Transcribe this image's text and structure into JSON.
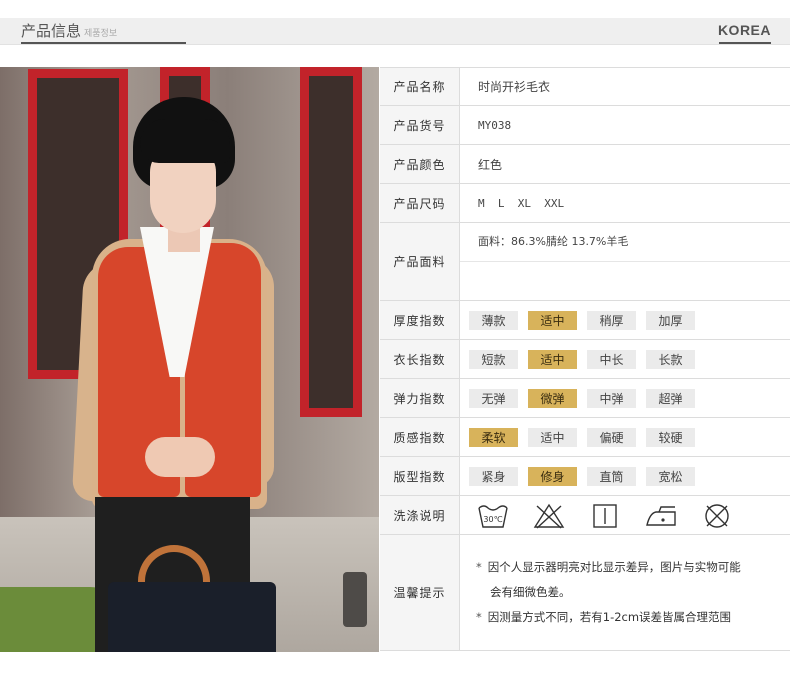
{
  "header": {
    "title": "产品信息",
    "subtitle": "제품정보",
    "brand": "KOREA"
  },
  "specs": {
    "name": {
      "label": "产品名称",
      "value": "时尚开衫毛衣"
    },
    "code": {
      "label": "产品货号",
      "value": "MY038"
    },
    "color": {
      "label": "产品颜色",
      "value": "红色"
    },
    "size": {
      "label": "产品尺码",
      "value": "M  L  XL  XXL"
    },
    "fabric": {
      "label": "产品面料",
      "value": "面料：86.3%腈纶 13.7%羊毛"
    }
  },
  "indices": [
    {
      "label": "厚度指数",
      "options": [
        "薄款",
        "适中",
        "稍厚",
        "加厚"
      ],
      "selected": 1
    },
    {
      "label": "衣长指数",
      "options": [
        "短款",
        "适中",
        "中长",
        "长款"
      ],
      "selected": 1
    },
    {
      "label": "弹力指数",
      "options": [
        "无弹",
        "微弹",
        "中弹",
        "超弹"
      ],
      "selected": 1
    },
    {
      "label": "质感指数",
      "options": [
        "柔软",
        "适中",
        "偏硬",
        "较硬"
      ],
      "selected": 0
    },
    {
      "label": "版型指数",
      "options": [
        "紧身",
        "修身",
        "直筒",
        "宽松"
      ],
      "selected": 1
    }
  ],
  "care": {
    "label": "洗涤说明",
    "wash_temp": "30℃",
    "icons": [
      "wash-30-icon",
      "no-bleach-icon",
      "line-dry-icon",
      "low-iron-icon",
      "no-dry-clean-icon"
    ]
  },
  "tips": {
    "label": "温馨提示",
    "bullet": "*",
    "line1": "因个人显示器明亮对比显示差异，图片与实物可能",
    "line1b": "会有细微色差。",
    "line2": "因测量方式不同，若有1-2cm误差皆属合理范围"
  },
  "colors": {
    "accent": "#d8b35b",
    "option_bg": "#ebebeb",
    "label_bg": "#f5f5f5"
  }
}
